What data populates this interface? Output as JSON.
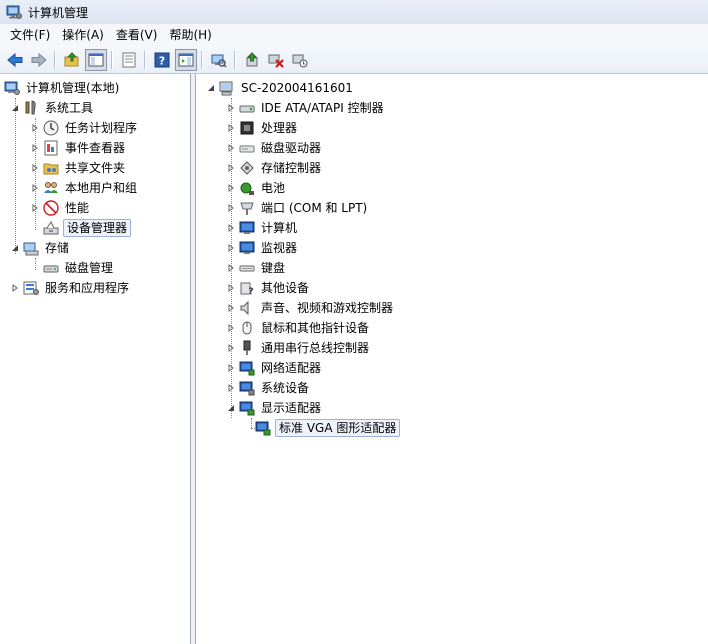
{
  "window": {
    "title": "计算机管理"
  },
  "menu": [
    "文件(F)",
    "操作(A)",
    "查看(V)",
    "帮助(H)"
  ],
  "toolbar": {
    "buttons": [
      {
        "name": "back-icon"
      },
      {
        "name": "forward-icon"
      },
      {
        "name": "up-folder-icon"
      },
      {
        "name": "show-hide-tree-icon"
      },
      {
        "name": "properties-icon"
      },
      {
        "name": "help-icon"
      },
      {
        "name": "show-action-pane-icon"
      },
      {
        "name": "scan-hardware-icon"
      },
      {
        "name": "update-driver-icon"
      },
      {
        "name": "disable-device-icon"
      },
      {
        "name": "uninstall-device-icon"
      }
    ]
  },
  "left_tree": {
    "root": "计算机管理(本地)",
    "system_tools": "系统工具",
    "task_scheduler": "任务计划程序",
    "event_viewer": "事件查看器",
    "shared_folders": "共享文件夹",
    "local_users": "本地用户和组",
    "performance": "性能",
    "device_manager": "设备管理器",
    "storage": "存储",
    "disk_management": "磁盘管理",
    "services_apps": "服务和应用程序"
  },
  "right_tree": {
    "computer": "SC-202004161601",
    "categories": [
      "IDE ATA/ATAPI 控制器",
      "处理器",
      "磁盘驱动器",
      "存储控制器",
      "电池",
      "端口 (COM 和 LPT)",
      "计算机",
      "监视器",
      "键盘",
      "其他设备",
      "声音、视频和游戏控制器",
      "鼠标和其他指针设备",
      "通用串行总线控制器",
      "网络适配器",
      "系统设备",
      "显示适配器"
    ],
    "display_child": "标准 VGA 图形适配器"
  },
  "colors": {
    "accent": "#2a62b5",
    "selection_border": "#9ab3d5"
  }
}
